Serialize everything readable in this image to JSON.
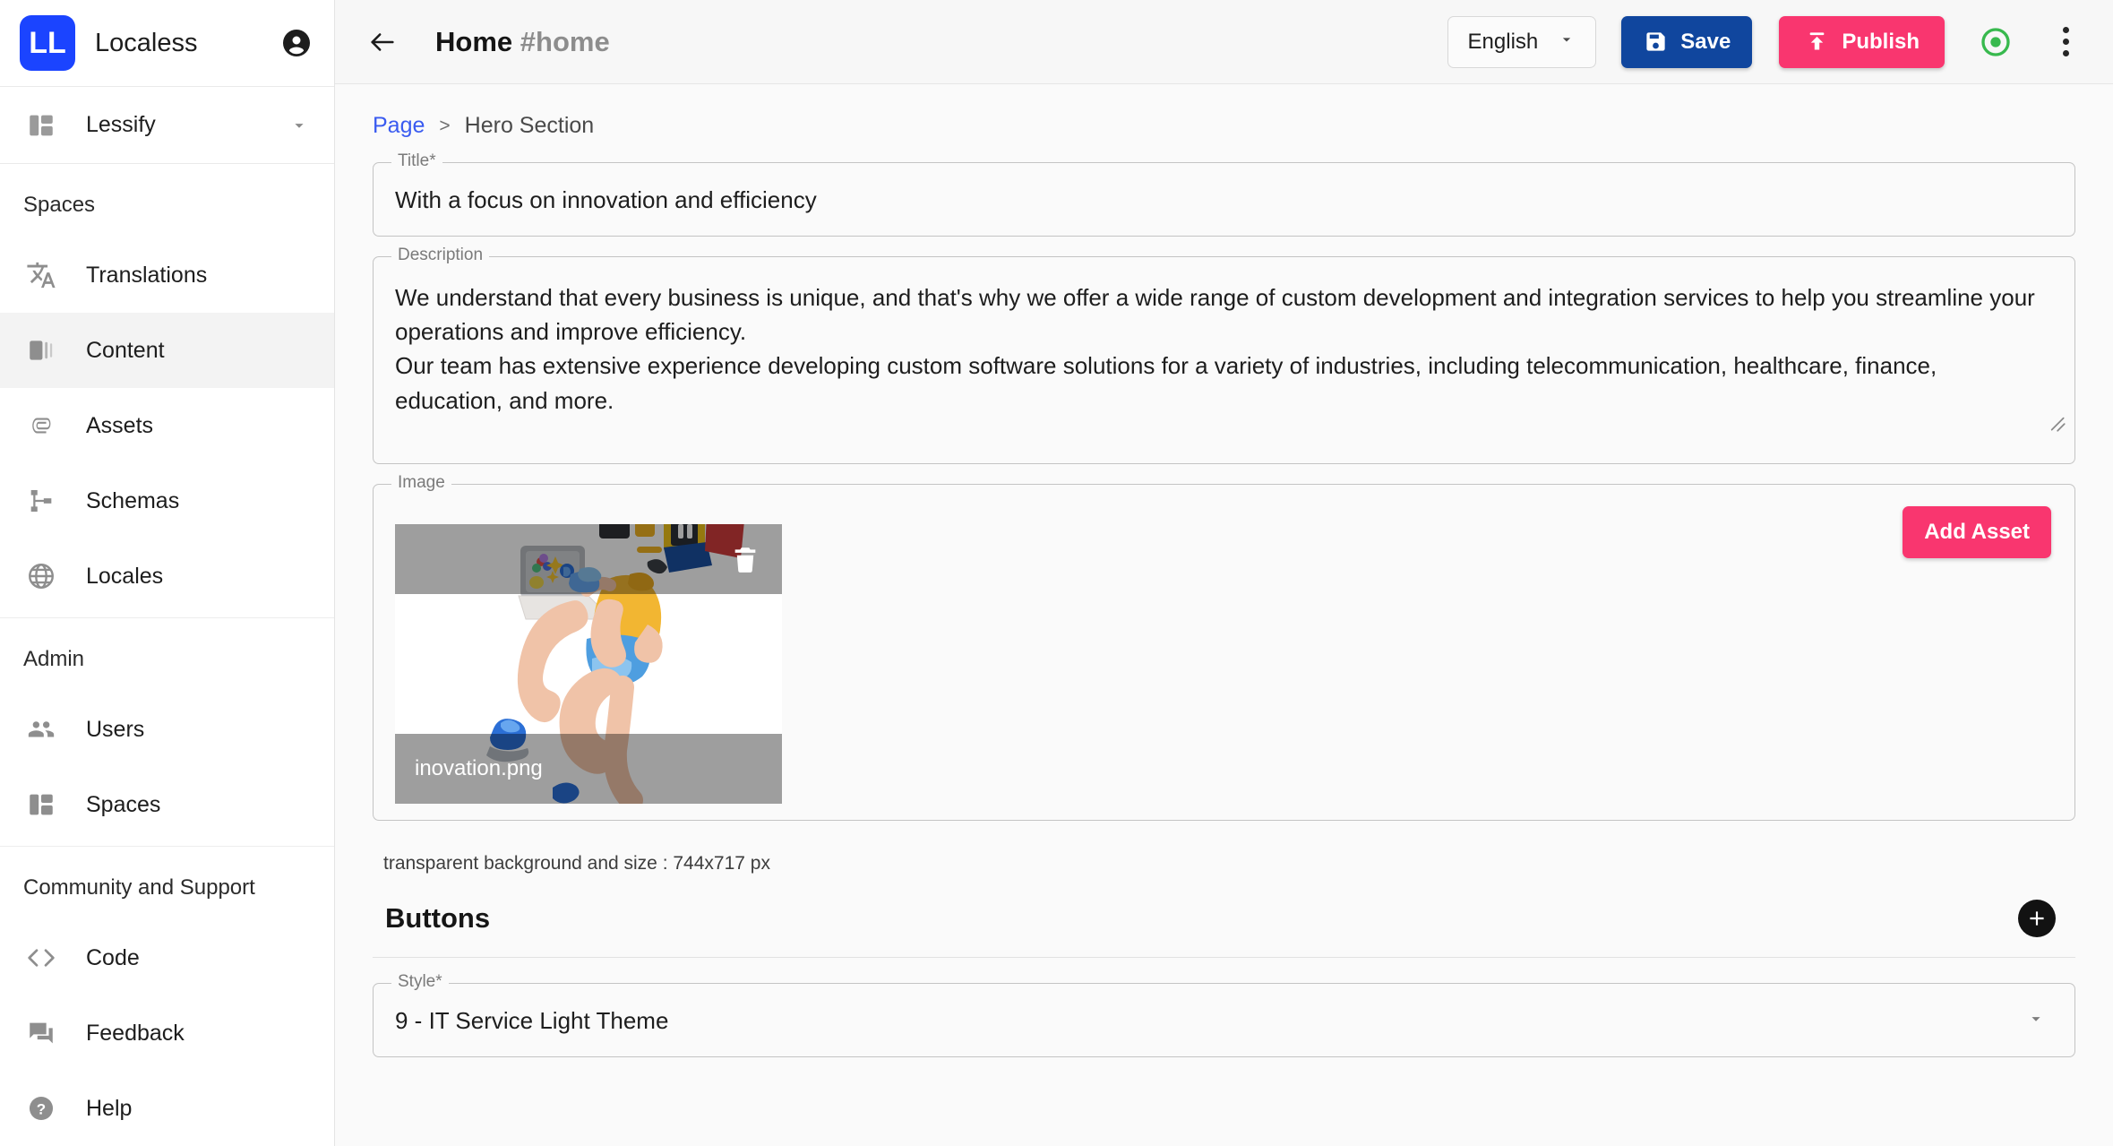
{
  "brand": {
    "logo_text": "LL",
    "name": "Localess",
    "logo_color": "#1b44ff",
    "account_icon": "account-circle-icon"
  },
  "sidebar": {
    "space_selector": {
      "label": "Lessify",
      "icon": "space-icon",
      "caret": "chevron-down-icon"
    },
    "groups": [
      {
        "title": "Spaces",
        "items": [
          {
            "label": "Translations",
            "icon": "translate-icon",
            "active": false
          },
          {
            "label": "Content",
            "icon": "content-icon",
            "active": true
          },
          {
            "label": "Assets",
            "icon": "paperclip-icon",
            "active": false
          },
          {
            "label": "Schemas",
            "icon": "schema-icon",
            "active": false
          },
          {
            "label": "Locales",
            "icon": "globe-icon",
            "active": false
          }
        ]
      },
      {
        "title": "Admin",
        "items": [
          {
            "label": "Users",
            "icon": "users-icon",
            "active": false
          },
          {
            "label": "Spaces",
            "icon": "space-icon",
            "active": false
          }
        ]
      },
      {
        "title": "Community and Support",
        "items": [
          {
            "label": "Code",
            "icon": "code-icon",
            "active": false
          },
          {
            "label": "Feedback",
            "icon": "feedback-icon",
            "active": false
          },
          {
            "label": "Help",
            "icon": "help-circle-icon",
            "active": false
          }
        ]
      }
    ]
  },
  "topbar": {
    "back_icon": "arrow-left-icon",
    "title": "Home",
    "title_handle": "#home",
    "language": {
      "label": "English",
      "caret": "chevron-down-icon"
    },
    "save": {
      "label": "Save",
      "icon": "save-disk-icon",
      "color": "#10469e"
    },
    "publish": {
      "label": "Publish",
      "icon": "publish-upload-icon",
      "color": "#f9366f"
    },
    "status_indicator": {
      "icon": "published-status-icon",
      "color": "#2eb84d"
    },
    "more_menu": {
      "icon": "kebab-menu-icon"
    }
  },
  "breadcrumb": {
    "root": "Page",
    "separator": ">",
    "current": "Hero Section"
  },
  "form": {
    "title_field": {
      "label": "Title*",
      "value": "With a focus on innovation and efficiency"
    },
    "description_field": {
      "label": "Description",
      "value": "We understand that every business is unique, and that's why we offer a wide range of custom development and integration services to help you streamline your operations and improve efficiency.\nOur team has extensive experience developing custom software solutions for a variety of industries, including telecommunication, healthcare, finance, education, and more.",
      "resize_handle": "resize-grip-icon"
    },
    "image_field": {
      "label": "Image",
      "add_asset_label": "Add Asset",
      "asset_name": "inovation.png",
      "delete_icon": "trash-icon",
      "note": "transparent background and size : 744x717 px"
    },
    "buttons_section": {
      "title": "Buttons",
      "add_icon": "plus-circle-icon"
    },
    "style_field": {
      "label": "Style*",
      "value": "9 - IT Service Light Theme",
      "caret": "chevron-down-icon"
    }
  }
}
